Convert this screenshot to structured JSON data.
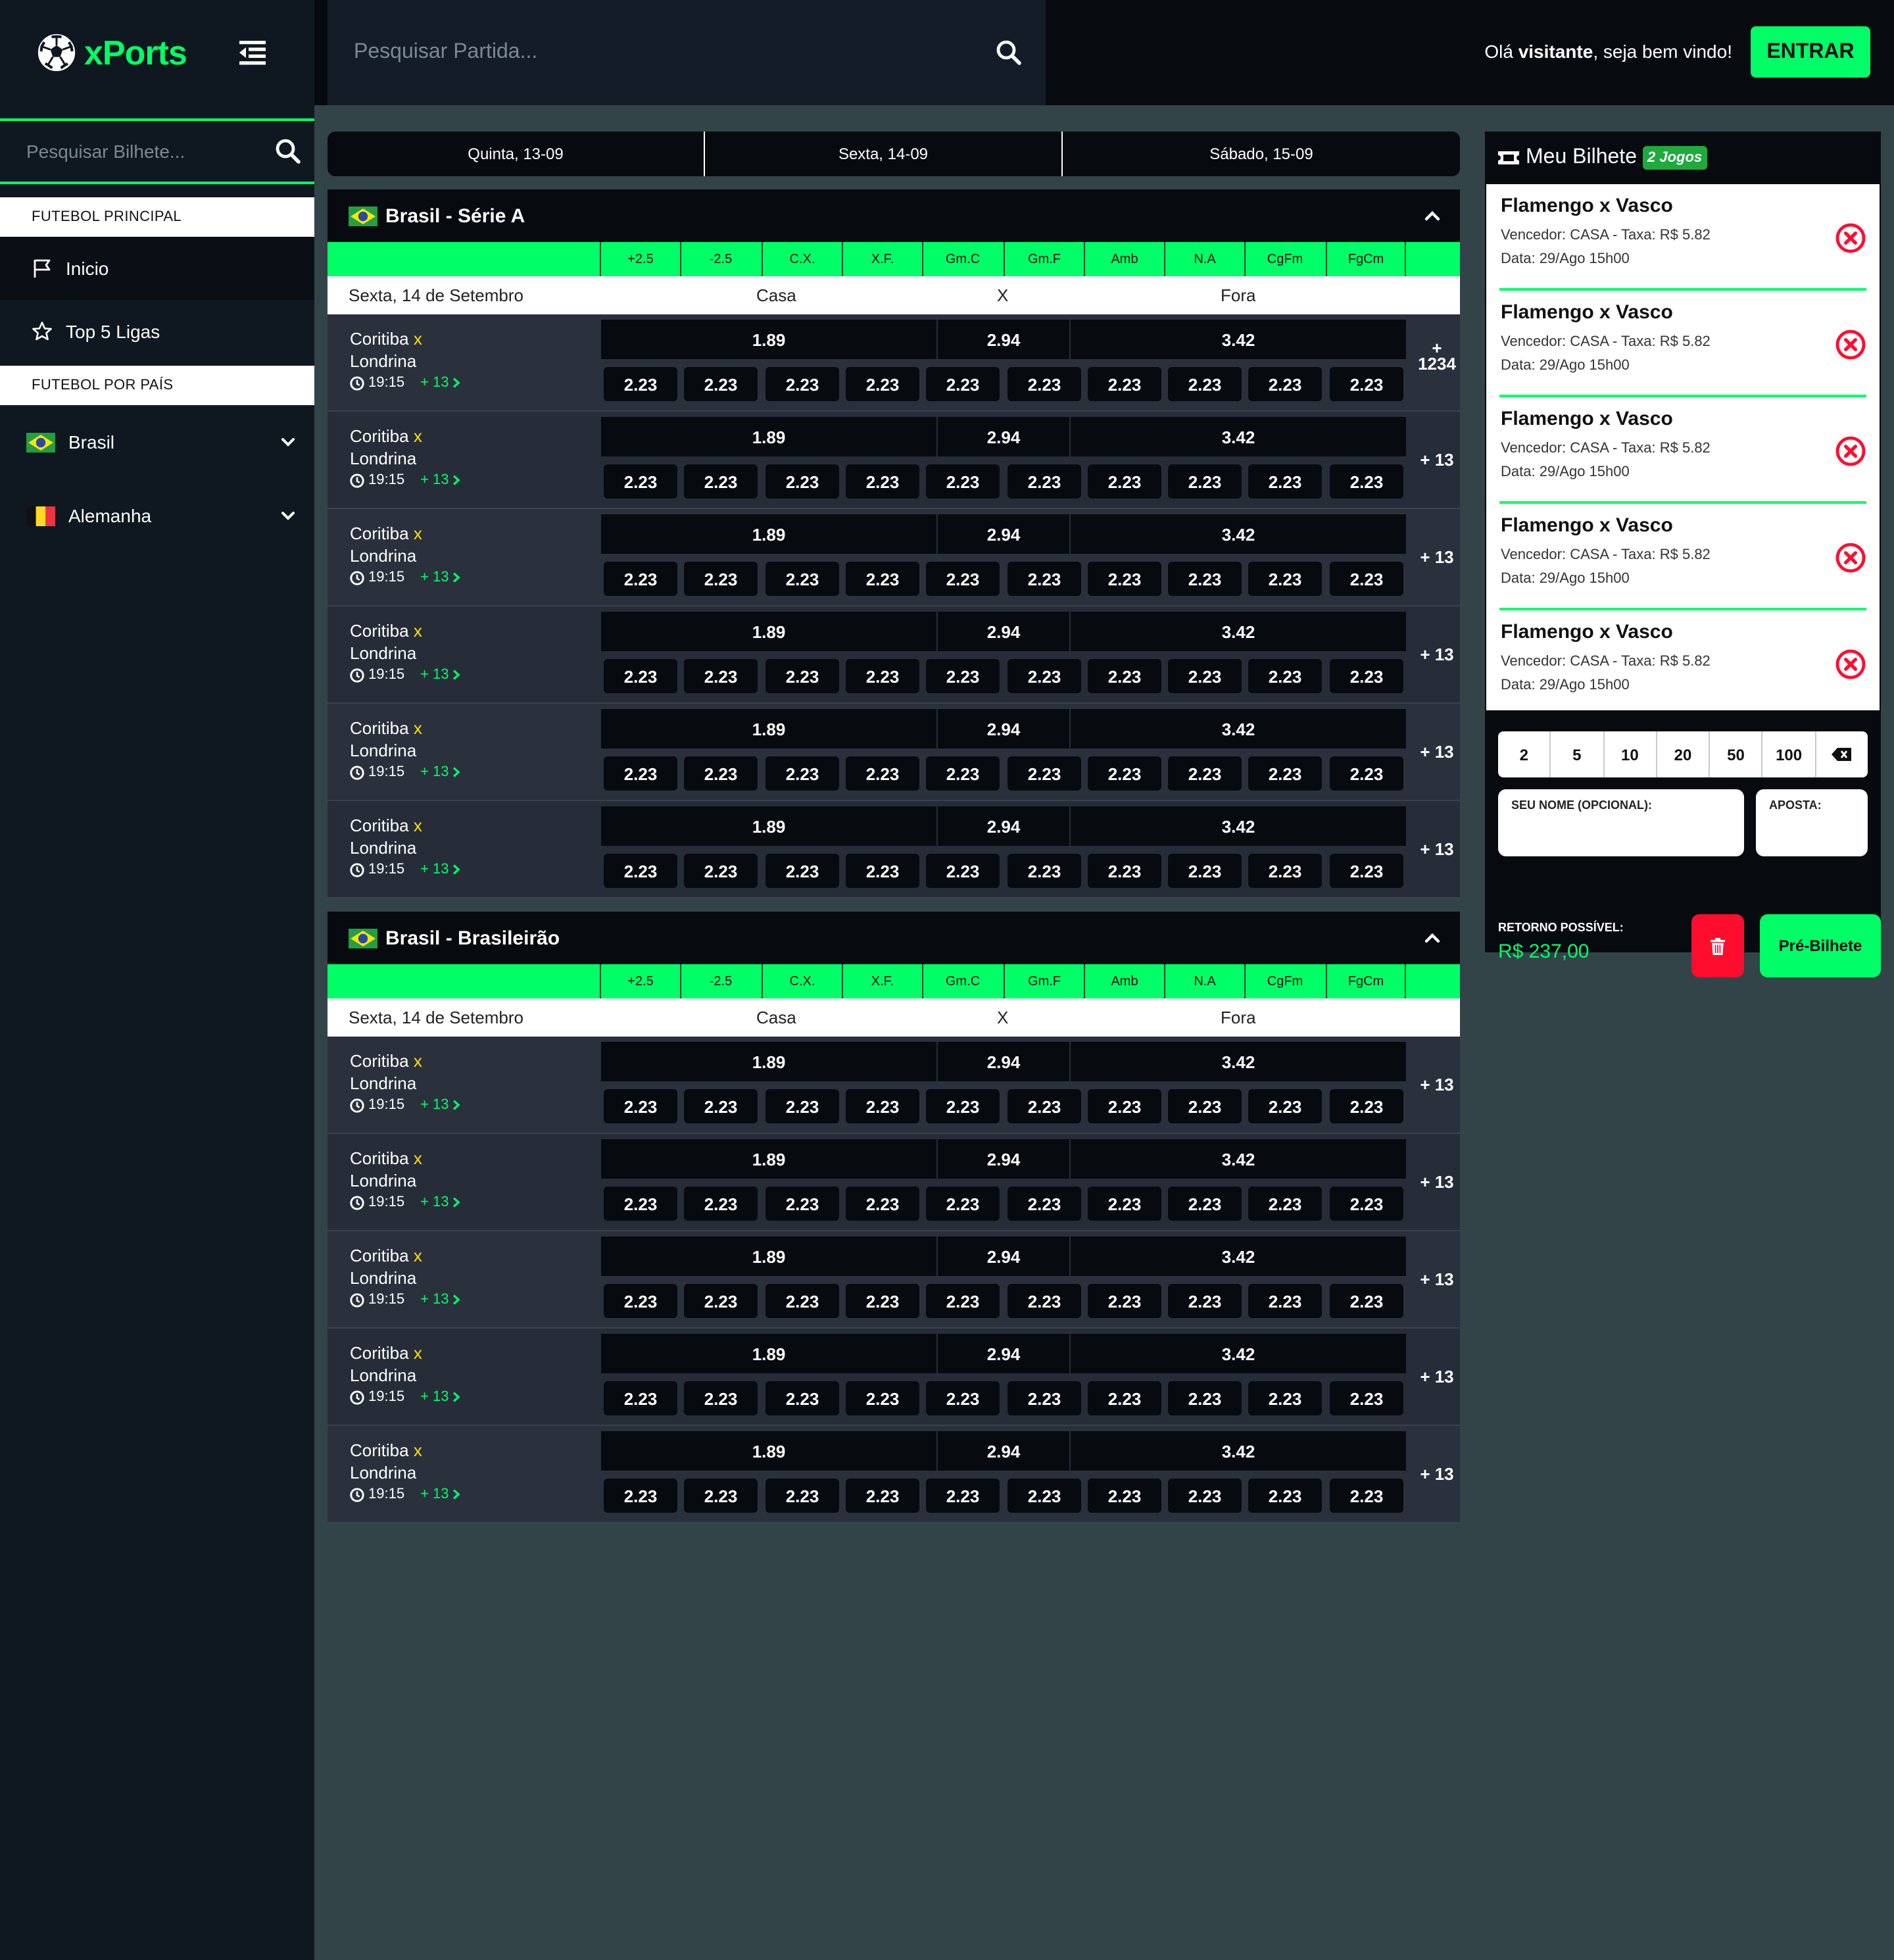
{
  "brand": {
    "name": "xPorts",
    "accent": "#00ff66"
  },
  "sidebar": {
    "search_placeholder": "Pesquisar Bilhete...",
    "section_main": "FUTEBOL PRINCIPAL",
    "nav": [
      {
        "label": "Inicio",
        "icon": "flag-icon",
        "active": true
      },
      {
        "label": "Top 5 Ligas",
        "icon": "star-icon",
        "active": false
      }
    ],
    "section_country": "FUTEBOL POR PAÍS",
    "countries": [
      {
        "label": "Brasil",
        "flag": "brazil-flag-icon"
      },
      {
        "label": "Alemanha",
        "flag": "belgium-flag-icon"
      }
    ]
  },
  "header": {
    "search_placeholder": "Pesquisar Partida...",
    "greeting_prefix": "Olá ",
    "greeting_name": "visitante",
    "greeting_suffix": ", seja bem vindo!",
    "login_label": "ENTRAR"
  },
  "date_tabs": [
    "Quinta, 13-09",
    "Sexta, 14-09",
    "Sábado, 15-09"
  ],
  "market_columns": [
    "+2.5",
    "-2.5",
    "C.X.",
    "X.F.",
    "Gm.C",
    "Gm.F",
    "Amb",
    "N.A",
    "CgFm",
    "FgCm"
  ],
  "leagues": [
    {
      "name": "Brasil - Série A",
      "date_label": "Sexta, 14 de Setembro",
      "home_label": "Casa",
      "draw_label": "X",
      "away_label": "Fora",
      "matches": [
        {
          "home": "Coritiba",
          "sep": "x",
          "away": "Londrina",
          "time": "19:15",
          "more": "+ 13",
          "odds_main": [
            "1.89",
            "2.94",
            "3.42"
          ],
          "odds_side": [
            "2.23",
            "2.23",
            "2.23",
            "2.23",
            "2.23",
            "2.23",
            "2.23",
            "2.23",
            "2.23",
            "2.23"
          ],
          "extra_top": "+",
          "extra": "1234"
        },
        {
          "home": "Coritiba",
          "sep": "x",
          "away": "Londrina",
          "time": "19:15",
          "more": "+ 13",
          "odds_main": [
            "1.89",
            "2.94",
            "3.42"
          ],
          "odds_side": [
            "2.23",
            "2.23",
            "2.23",
            "2.23",
            "2.23",
            "2.23",
            "2.23",
            "2.23",
            "2.23",
            "2.23"
          ],
          "extra": "+ 13"
        },
        {
          "home": "Coritiba",
          "sep": "x",
          "away": "Londrina",
          "time": "19:15",
          "more": "+ 13",
          "odds_main": [
            "1.89",
            "2.94",
            "3.42"
          ],
          "odds_side": [
            "2.23",
            "2.23",
            "2.23",
            "2.23",
            "2.23",
            "2.23",
            "2.23",
            "2.23",
            "2.23",
            "2.23"
          ],
          "extra": "+ 13"
        },
        {
          "home": "Coritiba",
          "sep": "x",
          "away": "Londrina",
          "time": "19:15",
          "more": "+ 13",
          "odds_main": [
            "1.89",
            "2.94",
            "3.42"
          ],
          "odds_side": [
            "2.23",
            "2.23",
            "2.23",
            "2.23",
            "2.23",
            "2.23",
            "2.23",
            "2.23",
            "2.23",
            "2.23"
          ],
          "extra": "+ 13"
        },
        {
          "home": "Coritiba",
          "sep": "x",
          "away": "Londrina",
          "time": "19:15",
          "more": "+ 13",
          "odds_main": [
            "1.89",
            "2.94",
            "3.42"
          ],
          "odds_side": [
            "2.23",
            "2.23",
            "2.23",
            "2.23",
            "2.23",
            "2.23",
            "2.23",
            "2.23",
            "2.23",
            "2.23"
          ],
          "extra": "+ 13"
        },
        {
          "home": "Coritiba",
          "sep": "x",
          "away": "Londrina",
          "time": "19:15",
          "more": "+ 13",
          "odds_main": [
            "1.89",
            "2.94",
            "3.42"
          ],
          "odds_side": [
            "2.23",
            "2.23",
            "2.23",
            "2.23",
            "2.23",
            "2.23",
            "2.23",
            "2.23",
            "2.23",
            "2.23"
          ],
          "extra": "+ 13"
        }
      ]
    },
    {
      "name": "Brasil - Brasileirão",
      "date_label": "Sexta, 14 de Setembro",
      "home_label": "Casa",
      "draw_label": "X",
      "away_label": "Fora",
      "matches": [
        {
          "home": "Coritiba",
          "sep": "x",
          "away": "Londrina",
          "time": "19:15",
          "more": "+ 13",
          "odds_main": [
            "1.89",
            "2.94",
            "3.42"
          ],
          "odds_side": [
            "2.23",
            "2.23",
            "2.23",
            "2.23",
            "2.23",
            "2.23",
            "2.23",
            "2.23",
            "2.23",
            "2.23"
          ],
          "extra": "+ 13"
        },
        {
          "home": "Coritiba",
          "sep": "x",
          "away": "Londrina",
          "time": "19:15",
          "more": "+ 13",
          "odds_main": [
            "1.89",
            "2.94",
            "3.42"
          ],
          "odds_side": [
            "2.23",
            "2.23",
            "2.23",
            "2.23",
            "2.23",
            "2.23",
            "2.23",
            "2.23",
            "2.23",
            "2.23"
          ],
          "extra": "+ 13"
        },
        {
          "home": "Coritiba",
          "sep": "x",
          "away": "Londrina",
          "time": "19:15",
          "more": "+ 13",
          "odds_main": [
            "1.89",
            "2.94",
            "3.42"
          ],
          "odds_side": [
            "2.23",
            "2.23",
            "2.23",
            "2.23",
            "2.23",
            "2.23",
            "2.23",
            "2.23",
            "2.23",
            "2.23"
          ],
          "extra": "+ 13"
        },
        {
          "home": "Coritiba",
          "sep": "x",
          "away": "Londrina",
          "time": "19:15",
          "more": "+ 13",
          "odds_main": [
            "1.89",
            "2.94",
            "3.42"
          ],
          "odds_side": [
            "2.23",
            "2.23",
            "2.23",
            "2.23",
            "2.23",
            "2.23",
            "2.23",
            "2.23",
            "2.23",
            "2.23"
          ],
          "extra": "+ 13"
        },
        {
          "home": "Coritiba",
          "sep": "x",
          "away": "Londrina",
          "time": "19:15",
          "more": "+ 13",
          "odds_main": [
            "1.89",
            "2.94",
            "3.42"
          ],
          "odds_side": [
            "2.23",
            "2.23",
            "2.23",
            "2.23",
            "2.23",
            "2.23",
            "2.23",
            "2.23",
            "2.23",
            "2.23"
          ],
          "extra": "+ 13"
        }
      ]
    }
  ],
  "slip": {
    "title": "Meu Bilhete",
    "badge": "2 Jogos",
    "items": [
      {
        "match": "Flamengo x Vasco",
        "detail": "Vencedor: CASA - Taxa: R$ 5.82",
        "date": "Data: 29/Ago 15h00"
      },
      {
        "match": "Flamengo x Vasco",
        "detail": "Vencedor: CASA - Taxa: R$ 5.82",
        "date": "Data: 29/Ago 15h00"
      },
      {
        "match": "Flamengo x Vasco",
        "detail": "Vencedor: CASA - Taxa: R$ 5.82",
        "date": "Data: 29/Ago 15h00"
      },
      {
        "match": "Flamengo x Vasco",
        "detail": "Vencedor: CASA - Taxa: R$ 5.82",
        "date": "Data: 29/Ago 15h00"
      },
      {
        "match": "Flamengo x Vasco",
        "detail": "Vencedor: CASA - Taxa: R$ 5.82",
        "date": "Data: 29/Ago 15h00"
      }
    ],
    "quick_amounts": [
      "2",
      "5",
      "10",
      "20",
      "50",
      "100"
    ],
    "name_label": "SEU NOME (OPCIONAL):",
    "name_value": "",
    "bet_label": "APOSTA:",
    "bet_value": "",
    "return_label": "RETORNO POSSÍVEL:",
    "return_value": "R$ 237,00",
    "pre_label": "Pré-Bilhete"
  },
  "colors": {
    "page_bg": "#334449",
    "sidebar_bg": "#0f1720",
    "dark": "#070b10",
    "remove": "#ff0d2f",
    "badge": "#1eaa3c",
    "team_sep": "#ffe000"
  }
}
